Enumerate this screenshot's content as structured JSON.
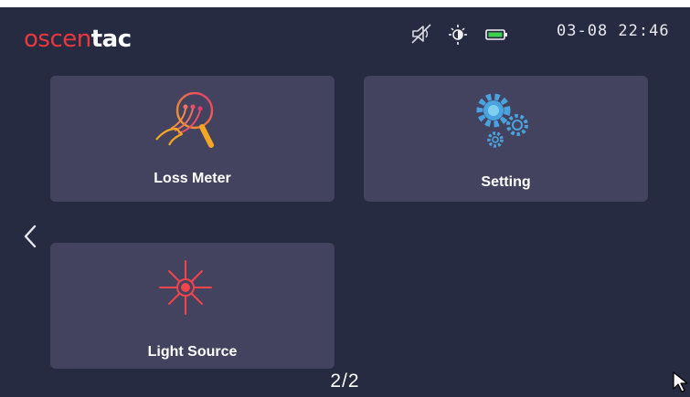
{
  "header": {
    "logo_part1": "oscen",
    "logo_part2": "tac",
    "datetime": "03-08 22:46",
    "status_icons": [
      "mute-icon",
      "brightness-icon",
      "battery-icon"
    ]
  },
  "tiles": [
    {
      "label": "Loss Meter",
      "icon": "loss-meter-icon"
    },
    {
      "label": "Setting",
      "icon": "gears-icon"
    },
    {
      "label": "Light Source",
      "icon": "light-source-icon"
    }
  ],
  "navigation": {
    "back_icon": "chevron-left-icon",
    "page_indicator": "2/2"
  },
  "colors": {
    "background": "#262b42",
    "tile": "#43435f",
    "brand_red": "#e8383d",
    "battery_green": "#3fcf4e",
    "gear_blue": "#4aa3df"
  }
}
